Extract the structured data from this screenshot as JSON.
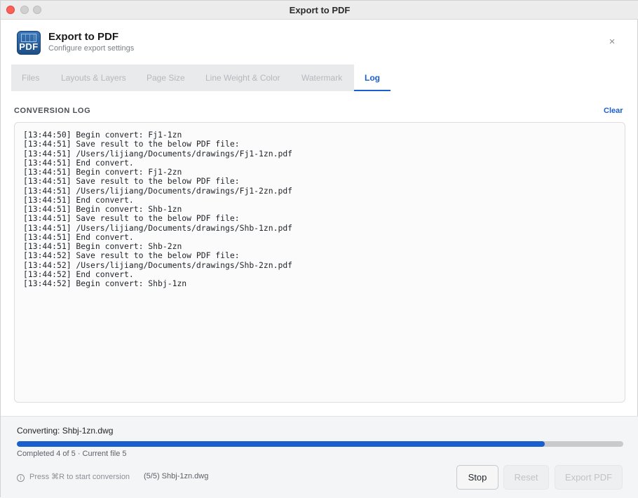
{
  "window": {
    "title": "Export to PDF"
  },
  "header": {
    "icon_text": "PDF",
    "title": "Export to PDF",
    "subtitle": "Configure export settings",
    "close_glyph": "×"
  },
  "tabs": [
    {
      "label": "Files",
      "active": false
    },
    {
      "label": "Layouts & Layers",
      "active": false
    },
    {
      "label": "Page Size",
      "active": false
    },
    {
      "label": "Line Weight & Color",
      "active": false
    },
    {
      "label": "Watermark",
      "active": false
    },
    {
      "label": "Log",
      "active": true
    }
  ],
  "log": {
    "section_label": "CONVERSION LOG",
    "clear_label": "Clear",
    "lines": [
      "[13:44:50] Begin convert: Fj1-1zn",
      "[13:44:51] Save result to the below PDF file:",
      "[13:44:51] /Users/lijiang/Documents/drawings/Fj1-1zn.pdf",
      "[13:44:51] End convert.",
      "[13:44:51] Begin convert: Fj1-2zn",
      "[13:44:51] Save result to the below PDF file:",
      "[13:44:51] /Users/lijiang/Documents/drawings/Fj1-2zn.pdf",
      "[13:44:51] End convert.",
      "[13:44:51] Begin convert: Shb-1zn",
      "[13:44:51] Save result to the below PDF file:",
      "[13:44:51] /Users/lijiang/Documents/drawings/Shb-1zn.pdf",
      "[13:44:51] End convert.",
      "[13:44:51] Begin convert: Shb-2zn",
      "[13:44:52] Save result to the below PDF file:",
      "[13:44:52] /Users/lijiang/Documents/drawings/Shb-2zn.pdf",
      "[13:44:52] End convert.",
      "[13:44:52] Begin convert: Shbj-1zn"
    ]
  },
  "footer": {
    "status": "Converting: Shbj-1zn.dwg",
    "progress_fraction": 0.87,
    "progress_text": "Completed 4 of 5 · Current file 5",
    "hint_icon_glyph": "i",
    "hint": "Press ⌘R to start conversion",
    "file_hint": "(5/5) Shbj-1zn.dwg",
    "buttons": {
      "stop": "Stop",
      "reset": "Reset",
      "export": "Export PDF"
    }
  },
  "colors": {
    "accent": "#1a5fd0",
    "close_button": "#fe5f57"
  }
}
